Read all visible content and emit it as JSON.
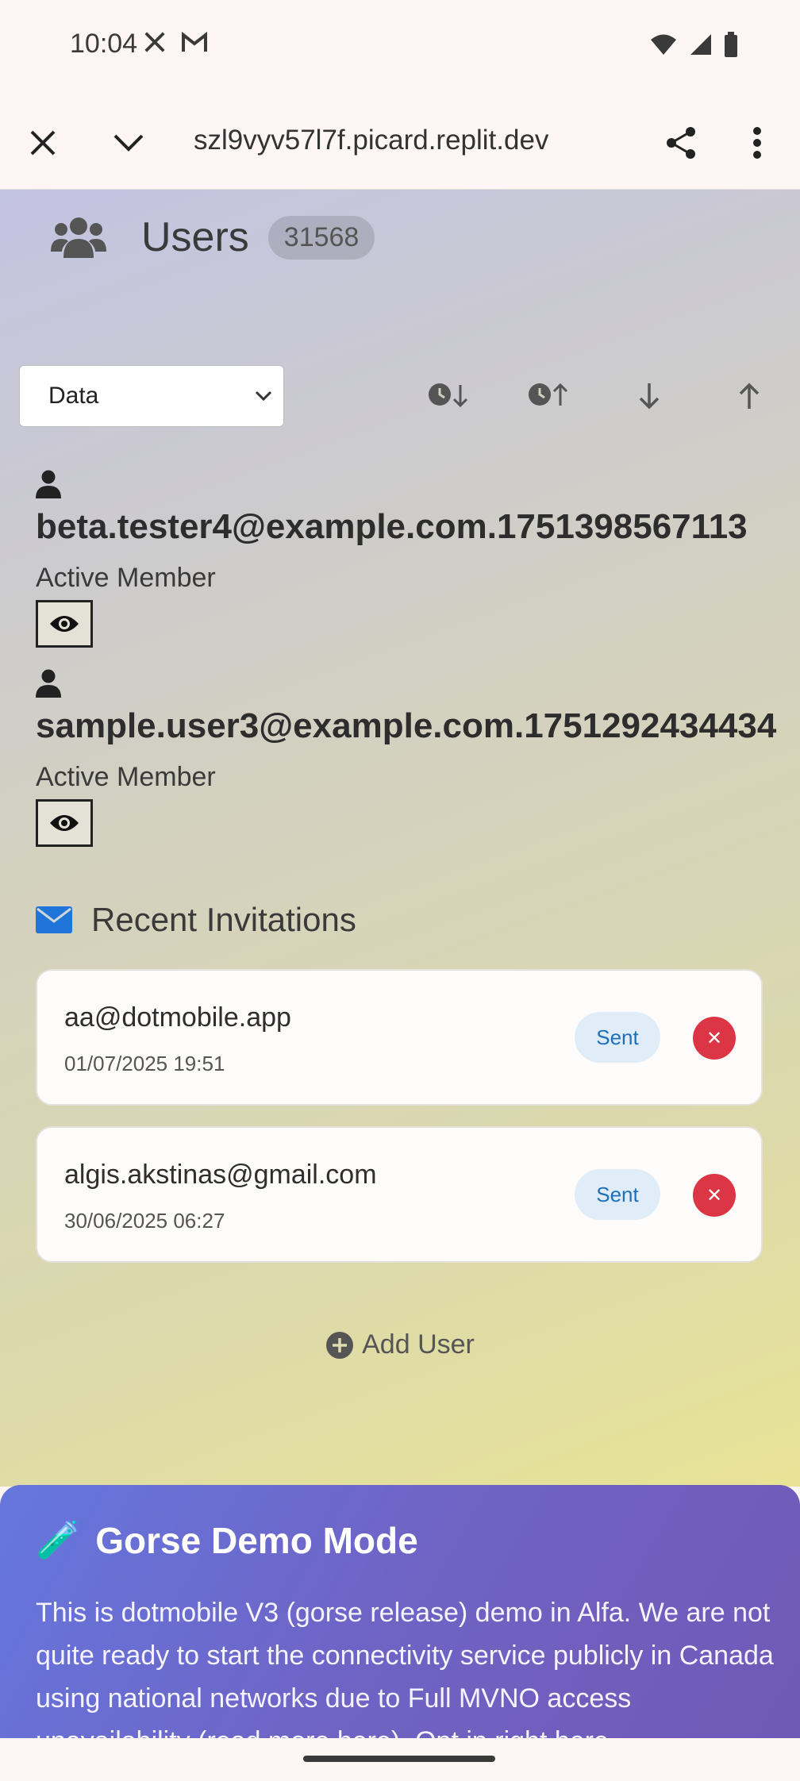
{
  "status_bar": {
    "time": "10:04",
    "icons": [
      "x-logo-icon",
      "gmail-icon",
      "wifi-icon",
      "signal-icon",
      "battery-icon"
    ]
  },
  "browser": {
    "url": "szl9vyv57l7f.picard.replit.dev",
    "icons": [
      "close-icon",
      "chevron-down-icon",
      "share-icon",
      "more-vert-icon"
    ]
  },
  "users_header": {
    "title": "Users",
    "count": "31568",
    "icon": "users-icon"
  },
  "filter": {
    "selected": "Data",
    "sort_icons": [
      "clock-sort-down-icon",
      "clock-sort-up-icon",
      "arrow-down-icon",
      "arrow-up-icon"
    ]
  },
  "users": [
    {
      "email": "beta.tester4@example.com.1751398567113",
      "role": "Active Member"
    },
    {
      "email": "sample.user3@example.com.1751292434434",
      "role": "Active Member"
    }
  ],
  "invitations": {
    "title": "Recent Invitations",
    "items": [
      {
        "email": "aa@dotmobile.app",
        "date": "01/07/2025 19:51",
        "status": "Sent",
        "delete_glyph": "✕"
      },
      {
        "email": "algis.akstinas@gmail.com",
        "date": "30/06/2025 06:27",
        "status": "Sent",
        "delete_glyph": "✕"
      }
    ]
  },
  "add_user": {
    "label": "Add User"
  },
  "demo_banner": {
    "emoji": "🧪",
    "title": "Gorse Demo Mode",
    "text": "This is dotmobile V3 (gorse release) demo in Alfa. We are not quite ready to start the connectivity service publicly in Canada using national networks due to Full MVNO access unavailability (read more here). Opt in right here"
  },
  "colors": {
    "accent_blue": "#1e6fb8",
    "danger_red": "#dc3545",
    "banner_purple": "#6f63c4",
    "mail_blue": "#1f74d9"
  }
}
